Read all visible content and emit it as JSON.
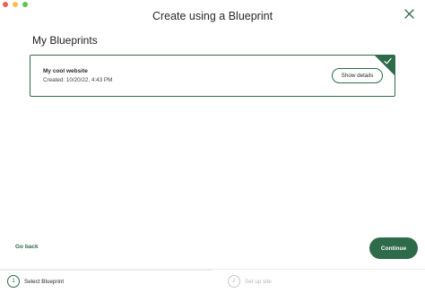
{
  "window": {
    "title": "Create using a Blueprint"
  },
  "section": {
    "title": "My Blueprints"
  },
  "blueprints": [
    {
      "name": "My cool website",
      "created": "Created: 10/20/22, 4:43 PM",
      "action_label": "Show details",
      "selected": true
    }
  ],
  "footer": {
    "back_label": "Go back",
    "continue_label": "Continue"
  },
  "steps": [
    {
      "number": "1",
      "label": "Select Blueprint",
      "active": true
    },
    {
      "number": "2",
      "label": "Set up site",
      "active": false
    }
  ],
  "colors": {
    "accent": "#2e6b4a",
    "close_icon": "#2e6b4a"
  },
  "icons": {
    "close": "close-icon",
    "check": "checkmark-icon"
  }
}
